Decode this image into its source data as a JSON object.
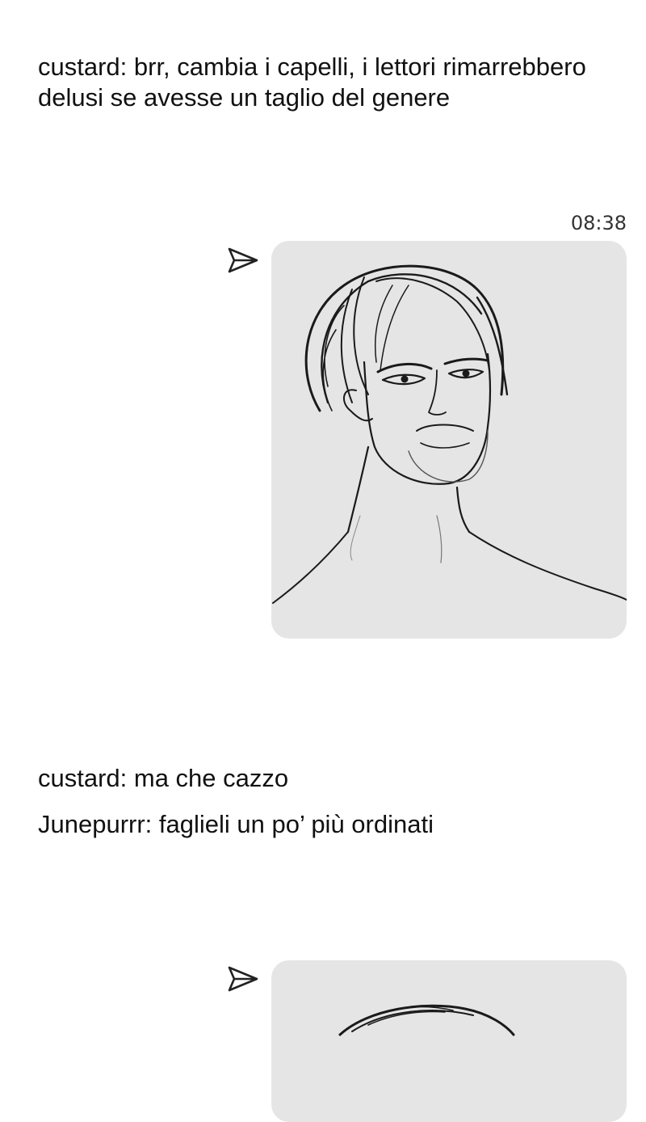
{
  "messages": {
    "caption_1": "custard: brr, cambia i capelli, i lettori rimarrebbero delusi se avesse un taglio del genere",
    "caption_2": "custard: ma che cazzo",
    "caption_3": "Junepurrr: faglieli un po’ più ordinati"
  },
  "attachment_1": {
    "time": "08:38",
    "icon": "send-icon"
  },
  "attachment_2": {
    "icon": "send-icon"
  },
  "colors": {
    "background": "#ffffff",
    "bubble": "#e5e5e5",
    "text": "#111111",
    "timestamp": "#333333"
  }
}
